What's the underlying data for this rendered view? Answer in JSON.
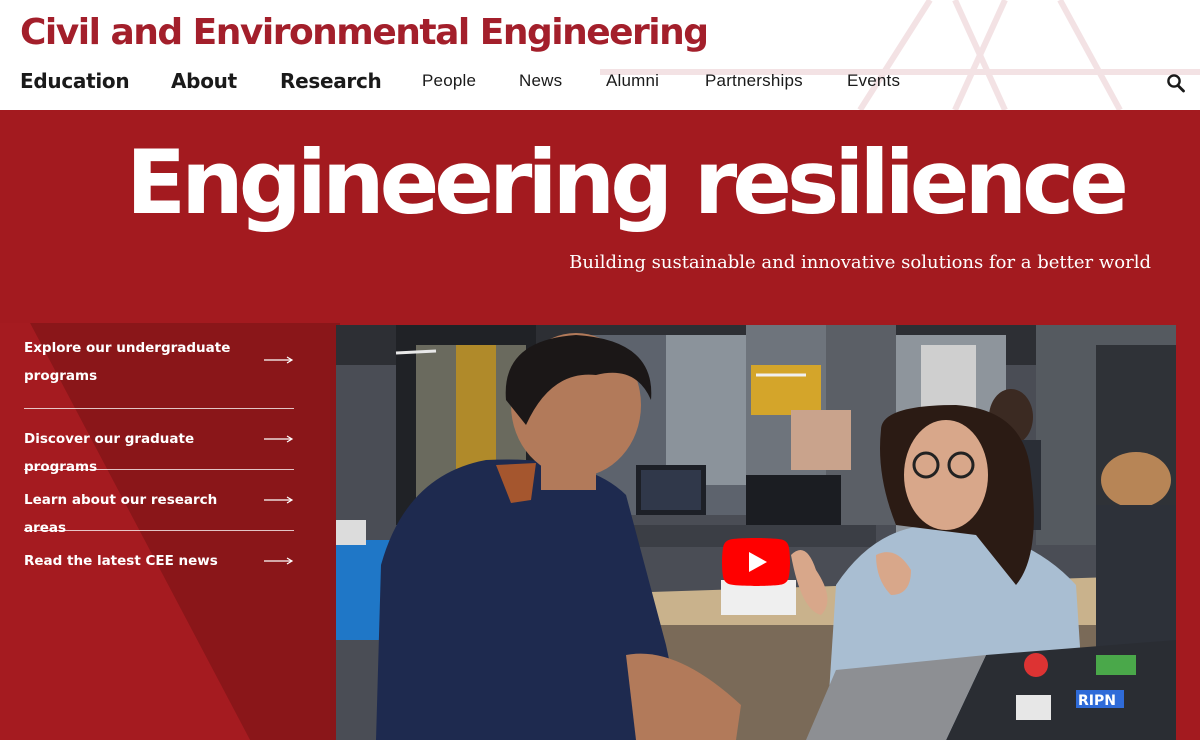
{
  "header": {
    "site_title": "Civil and Environmental Engineering",
    "brand_color": "#a31f2b",
    "nav_main": [
      "Education",
      "About",
      "Research"
    ],
    "nav_secondary": [
      "People",
      "News",
      "Alumni",
      "Partnerships",
      "Events"
    ],
    "search_icon": "search-icon"
  },
  "hero": {
    "background_color": "#a31a1f",
    "title": "Engineering resilience",
    "subtitle": "Building sustainable and innovative solutions for a better world",
    "links": [
      {
        "label": "Explore our undergraduate programs",
        "icon": "arrow-right-icon"
      },
      {
        "label": "Discover our graduate programs",
        "icon": "arrow-right-icon"
      },
      {
        "label": "Learn about our research areas",
        "icon": "arrow-right-icon"
      },
      {
        "label": "Read the latest CEE news",
        "icon": "arrow-right-icon"
      }
    ],
    "video": {
      "play_icon": "play-icon",
      "play_color": "#ff0000",
      "laptop_sticker_text": "RIPN"
    }
  }
}
